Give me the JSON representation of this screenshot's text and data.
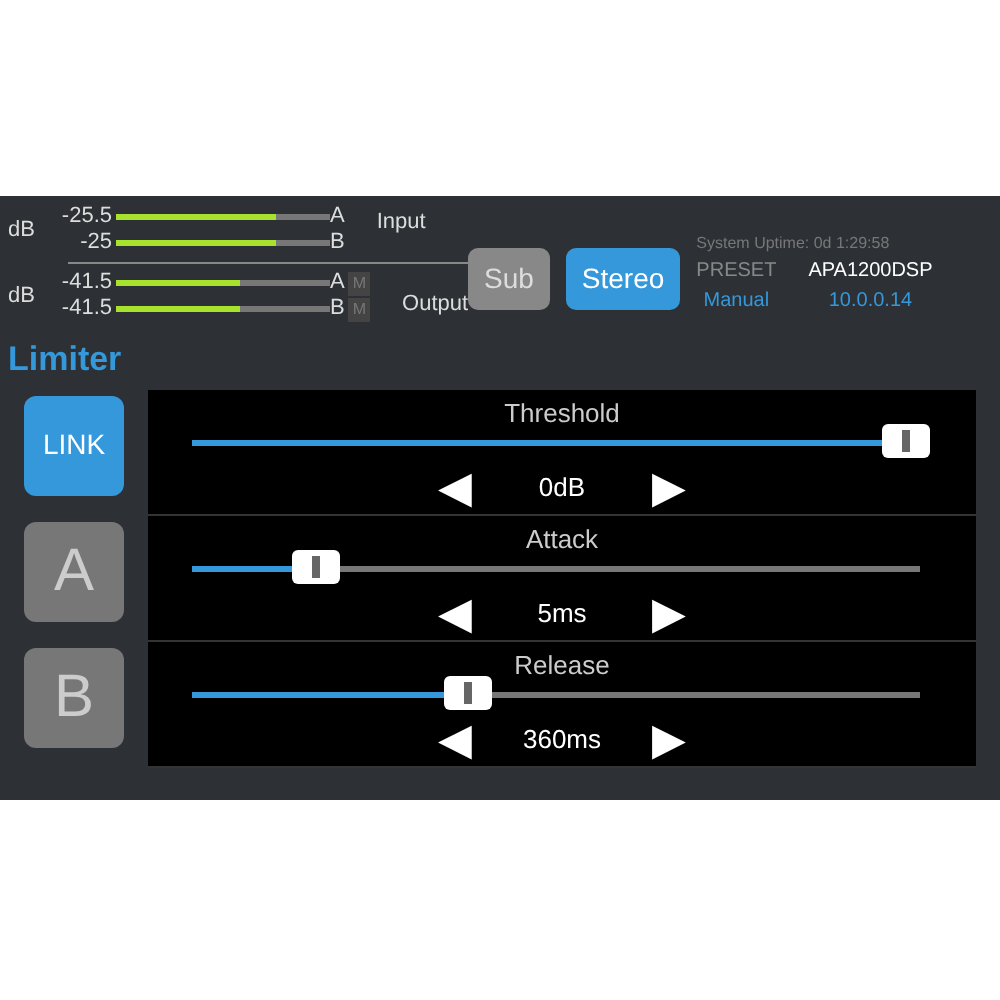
{
  "meters": {
    "unit_input": "dB",
    "unit_output": "dB",
    "input_label": "Input",
    "output_label": "Output",
    "input": [
      {
        "reading": "-25.5",
        "level": 0.75,
        "channel": "A"
      },
      {
        "reading": "-25",
        "level": 0.75,
        "channel": "B"
      }
    ],
    "output": [
      {
        "reading": "-41.5",
        "level": 0.58,
        "channel": "A",
        "mute": "M",
        "muted": false
      },
      {
        "reading": "-41.5",
        "level": 0.58,
        "channel": "B",
        "mute": "M",
        "muted": false
      }
    ]
  },
  "modes": [
    {
      "label": "Sub",
      "selected": false
    },
    {
      "label": "Stereo",
      "selected": true
    }
  ],
  "status": {
    "uptime": "System Uptime: 0d 1:29:58",
    "preset_label": "PRESET",
    "preset_value": "Manual",
    "device": "APA1200DSP",
    "ip": "10.0.0.14"
  },
  "section_title": "Limiter",
  "channels": [
    {
      "label": "LINK",
      "selected": true
    },
    {
      "label": "A",
      "selected": false
    },
    {
      "label": "B",
      "selected": false
    }
  ],
  "params": [
    {
      "name": "Threshold",
      "level": 0.98,
      "value": "0dB",
      "decrement": "◀",
      "increment": "▶"
    },
    {
      "name": "Attack",
      "level": 0.17,
      "value": "5ms",
      "decrement": "◀",
      "increment": "▶"
    },
    {
      "name": "Release",
      "level": 0.38,
      "value": "360ms",
      "decrement": "◀",
      "increment": "▶"
    }
  ]
}
